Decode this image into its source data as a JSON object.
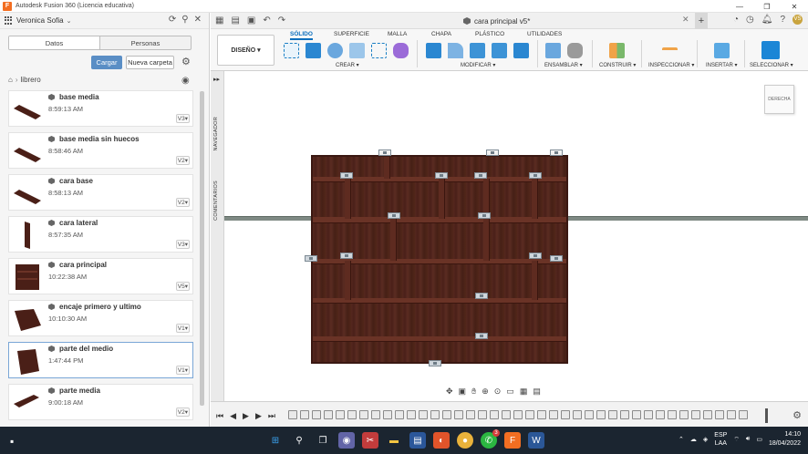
{
  "titlebar": {
    "title": "Autodesk Fusion 360 (Licencia educativa)",
    "logo": "F",
    "minimize": "—",
    "maximize": "❐",
    "close": "✕"
  },
  "left_panel": {
    "user_name": "Veronica Sofia",
    "tabs": [
      "Datos",
      "Personas"
    ],
    "upload_label": "Cargar",
    "new_folder_label": "Nueva carpeta",
    "breadcrumb": "librero",
    "files": [
      {
        "name": "base media",
        "time": "8:59:13 AM",
        "version": "V3"
      },
      {
        "name": "base media sin huecos",
        "time": "8:58:46 AM",
        "version": "V2"
      },
      {
        "name": "cara base",
        "time": "8:58:13 AM",
        "version": "V2"
      },
      {
        "name": "cara lateral",
        "time": "8:57:35 AM",
        "version": "V3"
      },
      {
        "name": "cara principal",
        "time": "10:22:38 AM",
        "version": "V5"
      },
      {
        "name": "encaje primero y ultimo",
        "time": "10:10:30 AM",
        "version": "V1"
      },
      {
        "name": "parte del medio",
        "time": "1:47:44 PM",
        "version": "V1"
      },
      {
        "name": "parte media",
        "time": "9:00:18 AM",
        "version": "V2"
      }
    ]
  },
  "document": {
    "tab_title": "cara principal v5*"
  },
  "ribbon": {
    "workspace": "DISEÑO ▾",
    "tabs": [
      "SÓLIDO",
      "SUPERFICIE",
      "MALLA",
      "CHAPA",
      "PLÁSTICO",
      "UTILIDADES"
    ],
    "groups": [
      "CREAR ▾",
      "MODIFICAR ▾",
      "ENSAMBLAR ▾",
      "CONSTRUIR ▾",
      "INSPECCIONAR ▾",
      "INSERTAR ▾",
      "SELECCIONAR ▾"
    ]
  },
  "viewport": {
    "browser_label": "NAVEGADOR",
    "comments_label": "COMENTARIOS",
    "navcube_label": "DERECHA"
  },
  "taskbar": {
    "lang_line1": "ESP",
    "lang_line2": "LAA",
    "time": "14:10",
    "date": "18/04/2022",
    "chrome_badge": "3"
  },
  "colors": {
    "accent": "#0a6ebd",
    "upload_btn": "#5a8ec5",
    "wood": "#4f241b",
    "taskbar": "#1b2530"
  }
}
